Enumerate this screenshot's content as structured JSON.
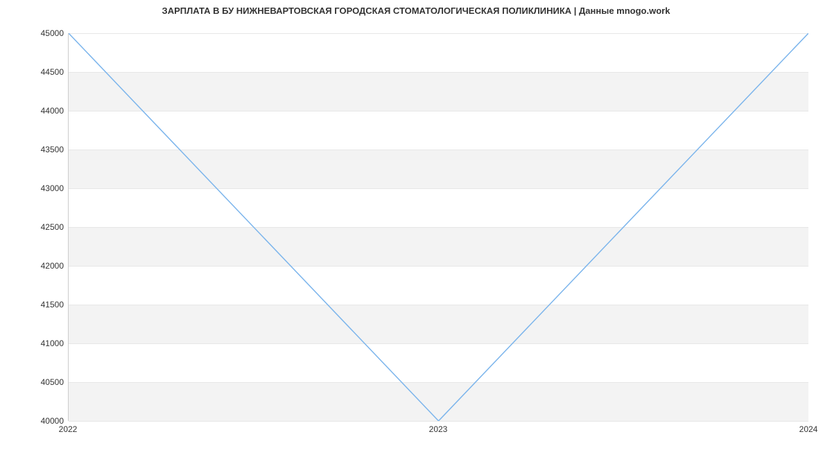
{
  "chart_data": {
    "type": "line",
    "title": "ЗАРПЛАТА В БУ НИЖНЕВАРТОВСКАЯ ГОРОДСКАЯ СТОМАТОЛОГИЧЕСКАЯ ПОЛИКЛИНИКА | Данные mnogo.work",
    "categories": [
      "2022",
      "2023",
      "2024"
    ],
    "values": [
      45000,
      40000,
      45000
    ],
    "ylim": [
      40000,
      45000
    ],
    "y_ticks": [
      40000,
      40500,
      41000,
      41500,
      42000,
      42500,
      43000,
      43500,
      44000,
      44500,
      45000
    ],
    "xlabel": "",
    "ylabel": "",
    "line_color": "#7cb5ec"
  }
}
